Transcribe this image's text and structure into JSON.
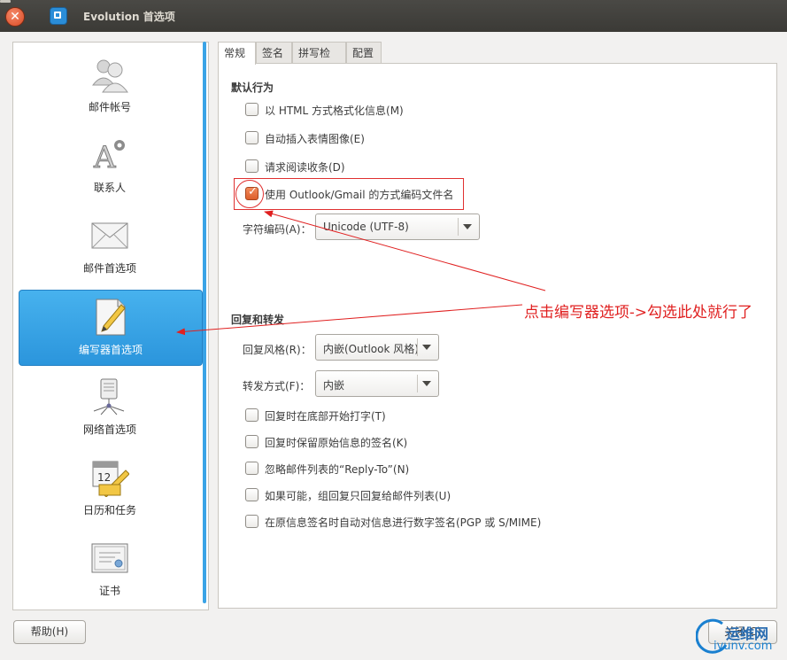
{
  "window": {
    "title": "Evolution 首选项"
  },
  "colors": {
    "accent": "#2b95dc",
    "checkbox_checked": "#dd5f2b",
    "annotation_red": "#e02020"
  },
  "sidebar": {
    "items": [
      {
        "label": "邮件帐号",
        "icon": "accounts-icon",
        "selected": false
      },
      {
        "label": "联系人",
        "icon": "contacts-icon",
        "selected": false
      },
      {
        "label": "邮件首选项",
        "icon": "mail-envelope-icon",
        "selected": false
      },
      {
        "label": "编写器首选项",
        "icon": "composer-notepad-icon",
        "selected": true
      },
      {
        "label": "网络首选项",
        "icon": "network-icon",
        "selected": false
      },
      {
        "label": "日历和任务",
        "icon": "calendar-icon",
        "selected": false
      },
      {
        "label": "证书",
        "icon": "certificate-icon",
        "selected": false
      }
    ]
  },
  "tabs": [
    {
      "label": "常规",
      "active": true
    },
    {
      "label": "签名",
      "active": false
    },
    {
      "label": "拼写检查",
      "active": false
    },
    {
      "label": "配置",
      "active": false
    }
  ],
  "general": {
    "default_behavior_title": "默认行为",
    "default_options": [
      {
        "label": "以 HTML 方式格式化信息(M)",
        "checked": false
      },
      {
        "label": "自动插入表情图像(E)",
        "checked": false
      },
      {
        "label": "请求阅读收条(D)",
        "checked": false
      },
      {
        "label": "使用 Outlook/Gmail 的方式编码文件名",
        "checked": true
      }
    ],
    "charset_label": "字符编码(A)：",
    "charset_value": "Unicode (UTF-8)",
    "reply_forward_title": "回复和转发",
    "reply_style_label": "回复风格(R)：",
    "reply_style_value": "内嵌(Outlook 风格)",
    "forward_style_label": "转发方式(F)：",
    "forward_style_value": "内嵌",
    "reply_options": [
      {
        "label": "回复时在底部开始打字(T)",
        "checked": false
      },
      {
        "label": "回复时保留原始信息的签名(K)",
        "checked": false
      },
      {
        "label": "忽略邮件列表的“Reply-To”(N)",
        "checked": false
      },
      {
        "label": "如果可能，组回复只回复给邮件列表(U)",
        "checked": false
      },
      {
        "label": "在原信息签名时自动对信息进行数字签名(PGP 或 S/MIME)",
        "checked": false
      }
    ]
  },
  "buttons": {
    "help": "帮助(H)",
    "close": "关闭(C)"
  },
  "annotation": {
    "text": "点击编写器选项->勾选此处就行了"
  },
  "watermark": {
    "line1": "运维网",
    "line2": "iyunv.com"
  }
}
